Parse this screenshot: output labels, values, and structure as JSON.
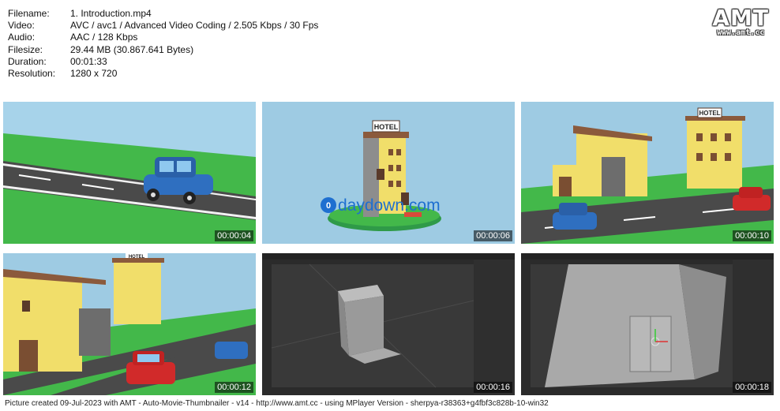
{
  "info": {
    "filename": {
      "label": "Filename:",
      "value": "1. Introduction.mp4"
    },
    "video": {
      "label": "Video:",
      "value": "AVC / avc1 / Advanced Video Coding / 2.505 Kbps / 30 Fps"
    },
    "audio": {
      "label": "Audio:",
      "value": "AAC / 128 Kbps"
    },
    "filesize": {
      "label": "Filesize:",
      "value": "29.44 MB (30.867.641 Bytes)"
    },
    "duration": {
      "label": "Duration:",
      "value": "00:01:33"
    },
    "resolution": {
      "label": "Resolution:",
      "value": "1280 x 720"
    }
  },
  "logo": {
    "title": "AMT",
    "url": "www.amt.cc"
  },
  "thumbnails": [
    {
      "timestamp": "00:00:04"
    },
    {
      "timestamp": "00:00:06",
      "sign": "HOTEL",
      "watermark": "daydown.com"
    },
    {
      "timestamp": "00:00:10",
      "sign": "HOTEL"
    },
    {
      "timestamp": "00:00:12",
      "sign": "HOTEL"
    },
    {
      "timestamp": "00:00:16"
    },
    {
      "timestamp": "00:00:18"
    }
  ],
  "footer": "Picture created 09-Jul-2023 with AMT - Auto-Movie-Thumbnailer - v14 - http://www.amt.cc - using MPlayer Version - sherpya-r38363+g4fbf3c828b-10-win32",
  "colors": {
    "sky": "#9ecbe3",
    "grass": "#43b84a",
    "road": "#4a4a4a",
    "car_blue": "#2f6fc0",
    "car_red": "#d12a2a",
    "building_yellow": "#f1de6a",
    "blender_bg": "#393939"
  }
}
